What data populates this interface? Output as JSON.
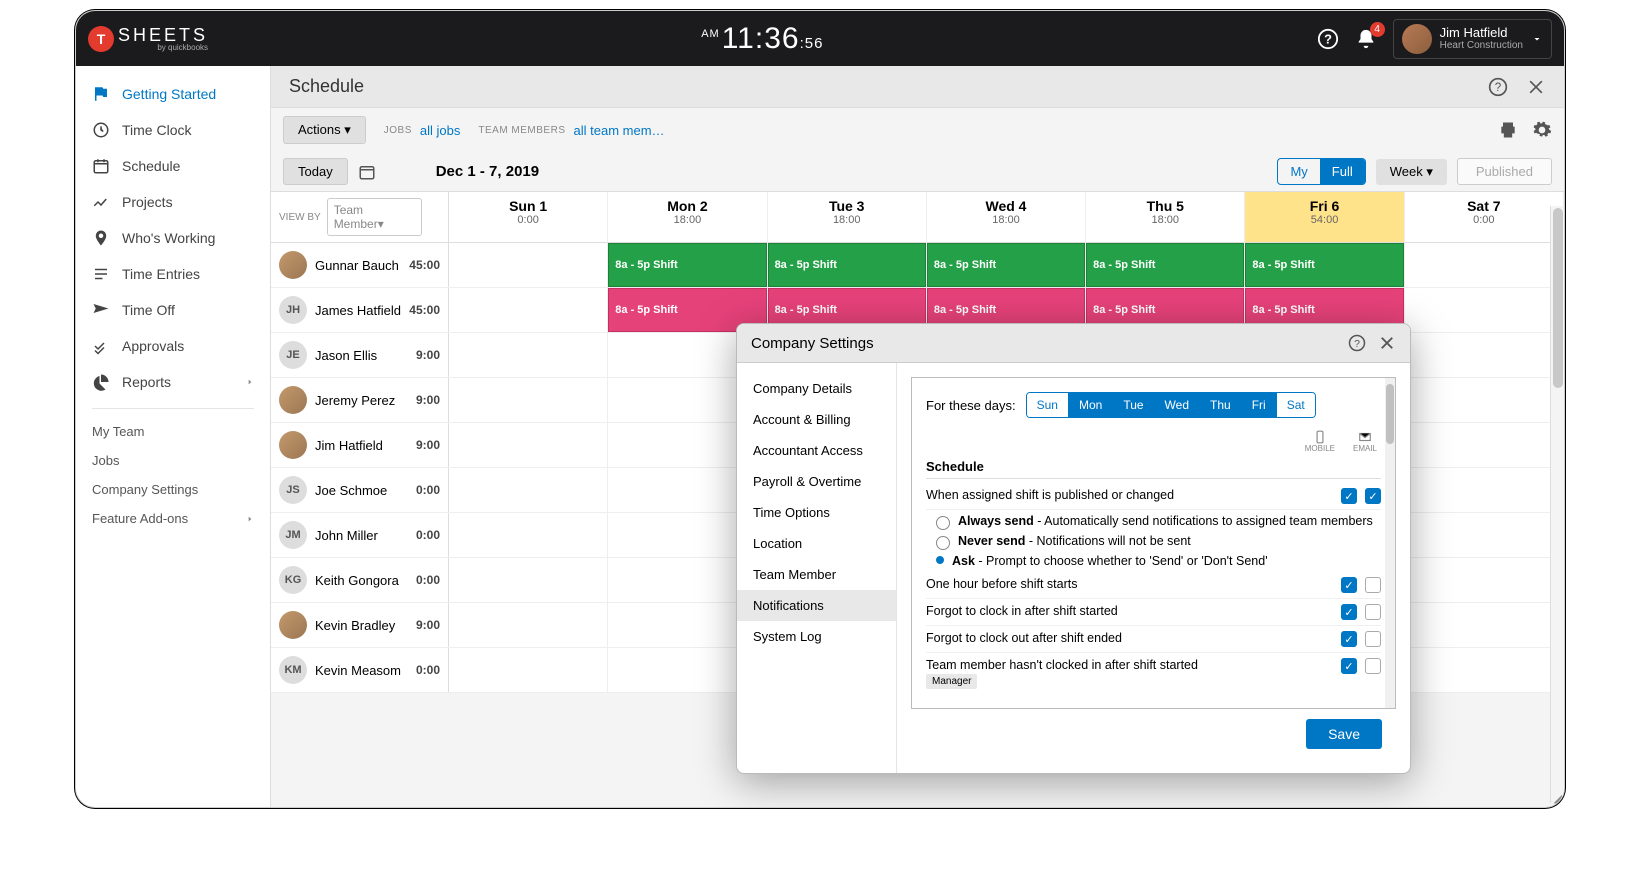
{
  "brand": {
    "letter": "T",
    "word": "SHEETS",
    "byline": "by quickbooks"
  },
  "clock": {
    "ampm": "AM",
    "hh": "11",
    "mm": "36",
    "ss": "56"
  },
  "notifications_count": "4",
  "user": {
    "name": "Jim Hatfield",
    "company": "Heart Construction"
  },
  "sidebar": {
    "items": [
      {
        "label": "Getting Started",
        "icon": "flag"
      },
      {
        "label": "Time Clock",
        "icon": "clock"
      },
      {
        "label": "Schedule",
        "icon": "calendar"
      },
      {
        "label": "Projects",
        "icon": "trend"
      },
      {
        "label": "Who's Working",
        "icon": "pin"
      },
      {
        "label": "Time Entries",
        "icon": "list"
      },
      {
        "label": "Time Off",
        "icon": "plane"
      },
      {
        "label": "Approvals",
        "icon": "check"
      },
      {
        "label": "Reports",
        "icon": "pie"
      }
    ],
    "secondary": [
      "My Team",
      "Jobs",
      "Company Settings",
      "Feature Add-ons"
    ]
  },
  "page": {
    "title": "Schedule"
  },
  "toolbar": {
    "actions": "Actions",
    "jobs_label": "JOBS",
    "jobs_link": "all jobs",
    "members_label": "TEAM MEMBERS",
    "members_link": "all team mem…",
    "today": "Today",
    "date_range": "Dec 1 - 7, 2019",
    "seg_my": "My",
    "seg_full": "Full",
    "week": "Week",
    "published": "Published",
    "viewby": "VIEW BY",
    "viewby_value": "Team Member"
  },
  "days": [
    {
      "label": "Sun 1",
      "hours": "0:00"
    },
    {
      "label": "Mon 2",
      "hours": "18:00"
    },
    {
      "label": "Tue 3",
      "hours": "18:00"
    },
    {
      "label": "Wed 4",
      "hours": "18:00"
    },
    {
      "label": "Thu 5",
      "hours": "18:00"
    },
    {
      "label": "Fri 6",
      "hours": "54:00"
    },
    {
      "label": "Sat 7",
      "hours": "0:00"
    }
  ],
  "shift_label": "8a - 5p Shift",
  "members": [
    {
      "name": "Gunnar Bauch",
      "hours": "45:00",
      "avatar": "img",
      "shifts": [
        null,
        "green",
        "green",
        "green",
        "green",
        "green",
        null
      ]
    },
    {
      "name": "James Hatfield",
      "hours": "45:00",
      "avatar": "JH",
      "shifts": [
        null,
        "pink",
        "pink",
        "pink",
        "pink",
        "pink",
        null
      ]
    },
    {
      "name": "Jason Ellis",
      "hours": "9:00",
      "avatar": "JE",
      "shifts": [
        null,
        null,
        null,
        null,
        null,
        "blue",
        null
      ]
    },
    {
      "name": "Jeremy Perez",
      "hours": "9:00",
      "avatar": "img",
      "shifts": [
        null,
        null,
        null,
        null,
        null,
        "orange",
        null
      ]
    },
    {
      "name": "Jim Hatfield",
      "hours": "9:00",
      "avatar": "img",
      "shifts": [
        null,
        null,
        null,
        null,
        null,
        "purple",
        null
      ]
    },
    {
      "name": "Joe Schmoe",
      "hours": "0:00",
      "avatar": "JS",
      "shifts": [
        null,
        null,
        null,
        null,
        null,
        null,
        null
      ]
    },
    {
      "name": "John Miller",
      "hours": "0:00",
      "avatar": "JM",
      "shifts": [
        null,
        null,
        null,
        null,
        null,
        null,
        null
      ]
    },
    {
      "name": "Keith Gongora",
      "hours": "0:00",
      "avatar": "KG",
      "shifts": [
        null,
        null,
        null,
        null,
        null,
        null,
        null
      ]
    },
    {
      "name": "Kevin Bradley",
      "hours": "9:00",
      "avatar": "img",
      "shifts": [
        null,
        null,
        null,
        null,
        null,
        "teal",
        null
      ]
    },
    {
      "name": "Kevin Measom",
      "hours": "0:00",
      "avatar": "KM",
      "shifts": [
        null,
        null,
        null,
        null,
        null,
        null,
        null
      ]
    }
  ],
  "modal": {
    "title": "Company Settings",
    "nav": [
      "Company Details",
      "Account & Billing",
      "Accountant Access",
      "Payroll & Overtime",
      "Time Options",
      "Location",
      "Team Member",
      "Notifications",
      "System Log"
    ],
    "for_these_days": "For these days:",
    "day_buttons": [
      {
        "label": "Sun",
        "on": false
      },
      {
        "label": "Mon",
        "on": true
      },
      {
        "label": "Tue",
        "on": true
      },
      {
        "label": "Wed",
        "on": true
      },
      {
        "label": "Thu",
        "on": true
      },
      {
        "label": "Fri",
        "on": true
      },
      {
        "label": "Sat",
        "on": false
      }
    ],
    "col_mobile": "MOBILE",
    "col_email": "EMAIL",
    "section": "Schedule",
    "row1": "When assigned shift is published or changed",
    "opt_always": "Always send",
    "opt_always_desc": " - Automatically send notifications to assigned team members",
    "opt_never": "Never send",
    "opt_never_desc": " - Notifications will not be sent",
    "opt_ask": "Ask",
    "opt_ask_desc": " - Prompt to choose whether to 'Send' or 'Don't Send'",
    "row2": "One hour before shift starts",
    "row3": "Forgot to clock in after shift started",
    "row4": "Forgot to clock out after shift ended",
    "row5": "Team member hasn't clocked in after shift started",
    "manager_tag": "Manager",
    "save": "Save"
  }
}
